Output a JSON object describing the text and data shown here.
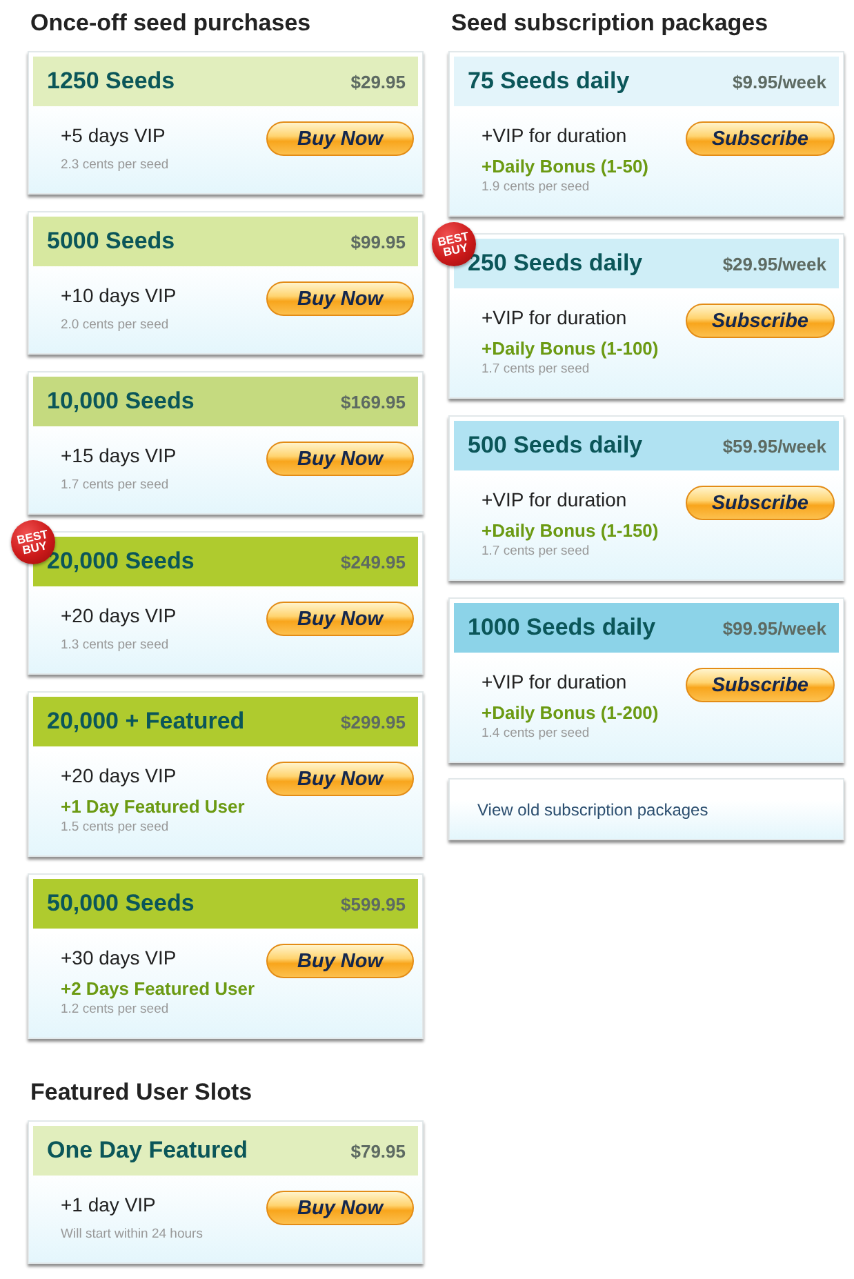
{
  "columns": [
    {
      "sections": [
        {
          "title": "Once-off seed purchases",
          "packages": [
            {
              "name": "1250 Seeds",
              "price": "$29.95",
              "color": "#e1eebd",
              "lines": [
                {
                  "kind": "perk",
                  "text": "+5 days VIP"
                },
                {
                  "kind": "note",
                  "text": "2.3 cents per seed"
                }
              ],
              "button": "Buy Now"
            },
            {
              "name": "5000 Seeds",
              "price": "$99.95",
              "color": "#d7e8a0",
              "lines": [
                {
                  "kind": "perk",
                  "text": "+10 days VIP"
                },
                {
                  "kind": "note",
                  "text": "2.0 cents per seed"
                }
              ],
              "button": "Buy Now"
            },
            {
              "name": "10,000 Seeds",
              "price": "$169.95",
              "color": "#c5da7f",
              "lines": [
                {
                  "kind": "perk",
                  "text": "+15 days VIP"
                },
                {
                  "kind": "note",
                  "text": "1.7 cents per seed"
                }
              ],
              "button": "Buy Now"
            },
            {
              "name": "20,000 Seeds",
              "price": "$249.95",
              "color": "#afcb2e",
              "badge": "BEST BUY",
              "lines": [
                {
                  "kind": "perk",
                  "text": "+20 days VIP"
                },
                {
                  "kind": "note",
                  "text": "1.3 cents per seed"
                }
              ],
              "button": "Buy Now"
            },
            {
              "name": "20,000 + Featured",
              "price": "$299.95",
              "color": "#afcb2e",
              "lines": [
                {
                  "kind": "perk",
                  "text": "+20 days VIP"
                },
                {
                  "kind": "bonus",
                  "text": "+1 Day Featured User"
                },
                {
                  "kind": "note",
                  "text": "1.5 cents per seed"
                }
              ],
              "button": "Buy Now"
            },
            {
              "name": "50,000 Seeds",
              "price": "$599.95",
              "color": "#afcb2e",
              "lines": [
                {
                  "kind": "perk",
                  "text": "+30 days VIP"
                },
                {
                  "kind": "bonus",
                  "text": "+2 Days Featured User"
                },
                {
                  "kind": "note",
                  "text": "1.2 cents per seed"
                }
              ],
              "button": "Buy Now"
            }
          ]
        },
        {
          "title": "Featured User Slots",
          "packages": [
            {
              "name": "One Day Featured",
              "price": "$79.95",
              "color": "#e1eebd",
              "lines": [
                {
                  "kind": "perk",
                  "text": "+1 day VIP"
                },
                {
                  "kind": "note",
                  "text": "Will start within 24 hours"
                }
              ],
              "button": "Buy Now"
            }
          ]
        }
      ]
    },
    {
      "sections": [
        {
          "title": "Seed subscription packages",
          "packages": [
            {
              "name": "75 Seeds daily",
              "price": "$9.95/week",
              "color": "#e3f4fa",
              "lines": [
                {
                  "kind": "perk",
                  "text": "+VIP for duration"
                },
                {
                  "kind": "bonus",
                  "text": "+Daily Bonus (1-50)"
                },
                {
                  "kind": "note",
                  "text": "1.9 cents per seed"
                }
              ],
              "button": "Subscribe"
            },
            {
              "name": "250 Seeds daily",
              "price": "$29.95/week",
              "color": "#cfeef7",
              "badge": "BEST BUY",
              "lines": [
                {
                  "kind": "perk",
                  "text": "+VIP for duration"
                },
                {
                  "kind": "bonus",
                  "text": "+Daily Bonus (1-100)"
                },
                {
                  "kind": "note",
                  "text": "1.7 cents per seed"
                }
              ],
              "button": "Subscribe"
            },
            {
              "name": "500 Seeds daily",
              "price": "$59.95/week",
              "color": "#b0e2f2",
              "lines": [
                {
                  "kind": "perk",
                  "text": "+VIP for duration"
                },
                {
                  "kind": "bonus",
                  "text": "+Daily Bonus (1-150)"
                },
                {
                  "kind": "note",
                  "text": "1.7 cents per seed"
                }
              ],
              "button": "Subscribe"
            },
            {
              "name": "1000 Seeds daily",
              "price": "$99.95/week",
              "color": "#8cd3e8",
              "lines": [
                {
                  "kind": "perk",
                  "text": "+VIP for duration"
                },
                {
                  "kind": "bonus",
                  "text": "+Daily Bonus (1-200)"
                },
                {
                  "kind": "note",
                  "text": "1.4 cents per seed"
                }
              ],
              "button": "Subscribe"
            }
          ],
          "link": "View old subscription packages"
        }
      ]
    }
  ]
}
